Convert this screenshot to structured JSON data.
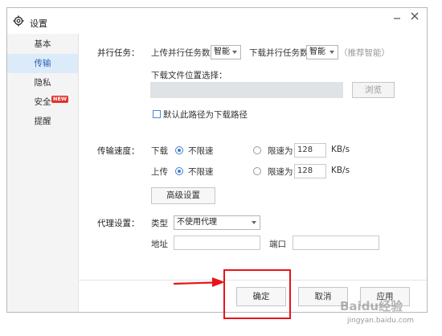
{
  "window": {
    "title": "设置"
  },
  "sidebar": {
    "items": [
      {
        "label": "基本"
      },
      {
        "label": "传输"
      },
      {
        "label": "隐私"
      },
      {
        "label": "安全",
        "badge": "NEW"
      },
      {
        "label": "提醒"
      }
    ]
  },
  "parallel": {
    "label": "并行任务：",
    "upload_label": "上传并行任务数",
    "upload_value": "智能",
    "download_label": "下载并行任务数",
    "download_value": "智能",
    "hint": "（推荐智能）"
  },
  "download_path": {
    "label": "下载文件位置选择：",
    "value": "",
    "browse_label": "浏览",
    "default_checkbox_label": "默认此路径为下载路径"
  },
  "speed": {
    "label": "传输速度：",
    "download": {
      "label": "下载",
      "unlimited_label": "不限速",
      "limit_label": "限速为",
      "limit_value": "128",
      "unit": "KB/s"
    },
    "upload": {
      "label": "上传",
      "unlimited_label": "不限速",
      "limit_label": "限速为",
      "limit_value": "128",
      "unit": "KB/s"
    },
    "advanced_label": "高级设置"
  },
  "proxy": {
    "label": "代理设置：",
    "type_label": "类型",
    "type_value": "不使用代理",
    "address_label": "地址",
    "address_value": "",
    "port_label": "端口",
    "port_value": ""
  },
  "footer": {
    "ok_label": "确定",
    "cancel_label": "取消",
    "apply_label": "应用"
  },
  "watermark": {
    "brand": "Baidu经验",
    "url": "jingyan.baidu.com"
  },
  "colors": {
    "accent": "#3d7fd6",
    "highlight_border": "#e8141b",
    "arrow": "#e8141b",
    "sidebar_active": "#dcebfa"
  }
}
